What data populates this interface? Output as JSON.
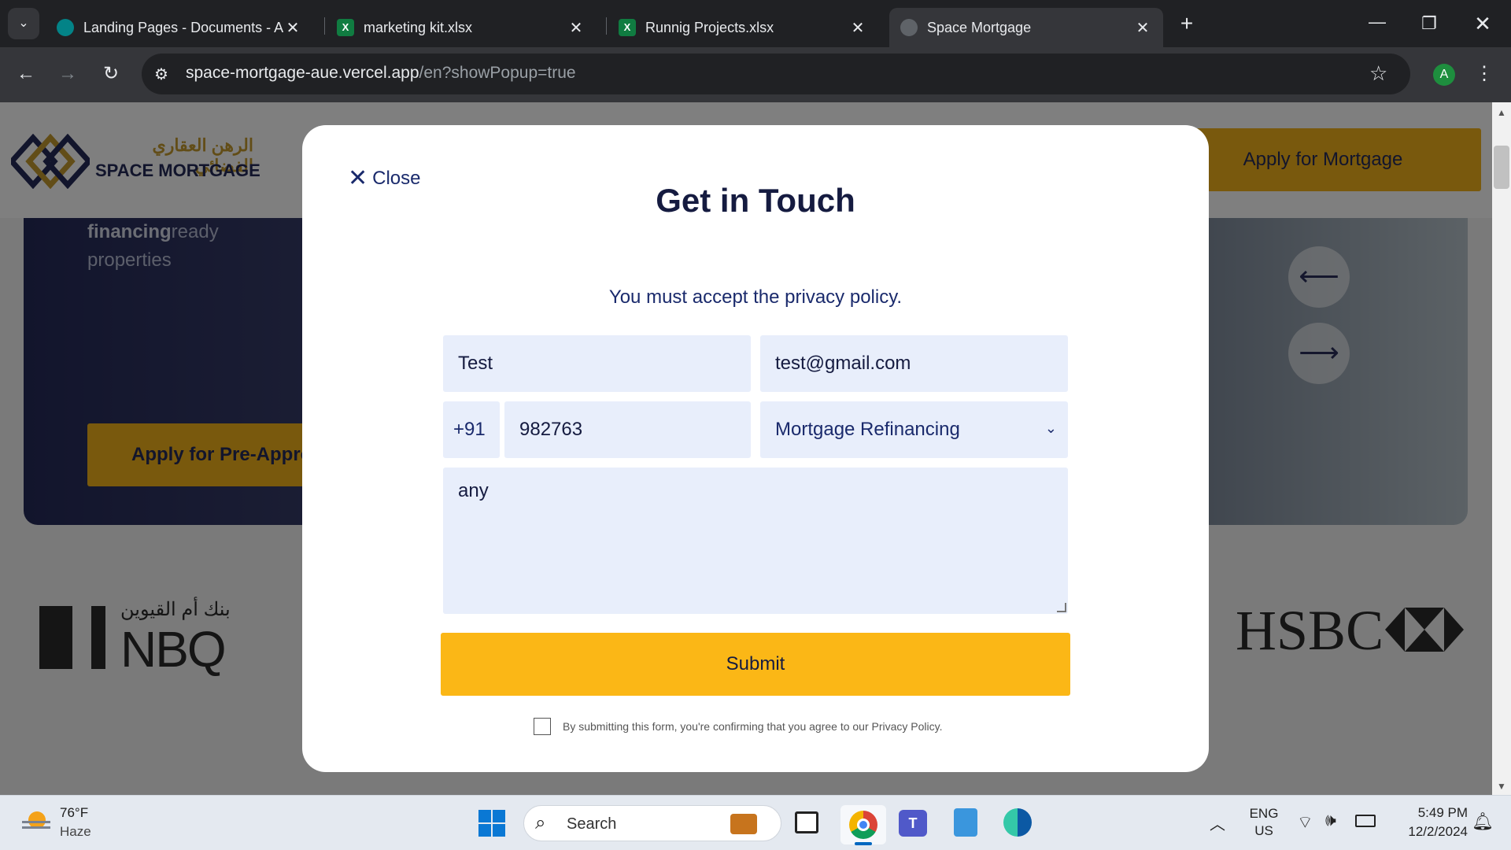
{
  "browser": {
    "tabs": [
      {
        "title": "Landing Pages - Documents - A",
        "icon": "sharepoint-icon",
        "active": false
      },
      {
        "title": "marketing kit.xlsx",
        "icon": "excel-icon",
        "active": false
      },
      {
        "title": "Runnig Projects.xlsx",
        "icon": "excel-icon",
        "active": false
      },
      {
        "title": "Space Mortgage",
        "icon": "globe-icon",
        "active": true
      }
    ],
    "url_host": "space-mortgage-aue.vercel.app",
    "url_path": "/en?showPopup=true",
    "profile_initial": "A"
  },
  "site": {
    "logo_arabic": "الرهن العقاري الفضائي",
    "logo_text": "SPACE MORTGAGE",
    "apply_mortgage_label": "Apply for Mortgage",
    "hero_text_bold": "financing",
    "hero_text_rest": "ready",
    "hero_text_line2": "properties",
    "pre_approval_label": "Apply for Pre-Appro",
    "partner_nbq_arabic": "بنك أم القيوين",
    "partner_nbq": "NBQ",
    "partner_hsbc": "HSBC",
    "colors": {
      "brand_navy": "#252a59",
      "brand_gold": "#fbb716"
    }
  },
  "modal": {
    "close_label": "Close",
    "title": "Get in Touch",
    "error_message": "You must accept the privacy policy.",
    "name_value": "Test",
    "email_value": "test@gmail.com",
    "country_code": "+91",
    "phone_value": "982763",
    "service_value": "Mortgage Refinancing",
    "message_value": "any",
    "submit_label": "Submit",
    "consent_text": "By submitting this form, you're confirming that you agree to our Privacy Policy.",
    "consent_checked": false
  },
  "taskbar": {
    "weather_temp": "76°F",
    "weather_desc": "Haze",
    "search_placeholder": "Search",
    "lang_line1": "ENG",
    "lang_line2": "US",
    "time": "5:49 PM",
    "date": "12/2/2024"
  }
}
